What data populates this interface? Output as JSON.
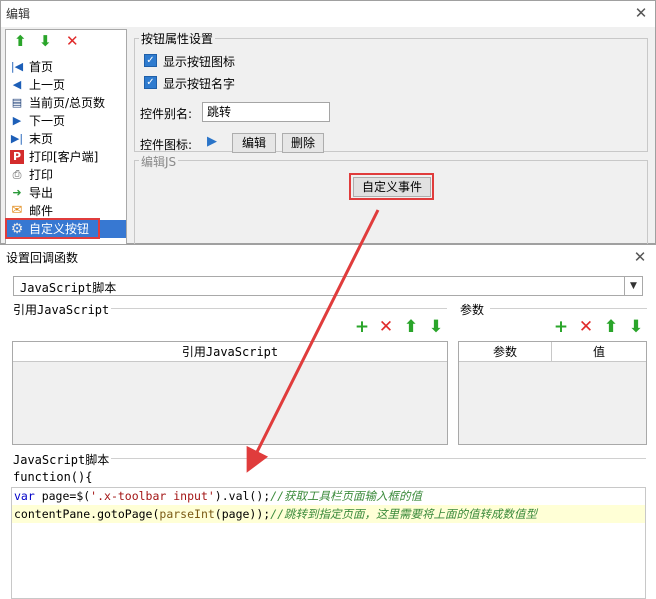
{
  "bg_dialog": {
    "title": "编辑",
    "close_glyph": "✕",
    "toolbar": [
      "move-up",
      "move-down",
      "delete"
    ],
    "items": [
      {
        "label": "首页",
        "icon": "first-page-icon",
        "glyph": "|◀"
      },
      {
        "label": "上一页",
        "icon": "prev-page-icon",
        "glyph": "◀"
      },
      {
        "label": "当前页/总页数",
        "icon": "page-count-icon",
        "glyph": "▤"
      },
      {
        "label": "下一页",
        "icon": "next-page-icon",
        "glyph": "▶"
      },
      {
        "label": "末页",
        "icon": "last-page-icon",
        "glyph": "▶|"
      },
      {
        "label": "打印[客户端]",
        "icon": "pdf-print-icon",
        "glyph": "P"
      },
      {
        "label": "打印",
        "icon": "printer-icon",
        "glyph": "⎙"
      },
      {
        "label": "导出",
        "icon": "export-icon",
        "glyph": "➜"
      },
      {
        "label": "邮件",
        "icon": "mail-icon",
        "glyph": "✉"
      },
      {
        "label": "自定义按钮",
        "icon": "gear-icon",
        "glyph": "⚙"
      }
    ],
    "button_props": {
      "title": "按钮属性设置",
      "show_icon": "显示按钮图标",
      "show_name": "显示按钮名字",
      "alias_label": "控件别名:",
      "alias_value": "跳转",
      "icon_label": "控件图标:",
      "edit_btn": "编辑",
      "delete_btn": "删除"
    },
    "edit_js": {
      "title": "编辑JS",
      "custom_event_btn": "自定义事件"
    }
  },
  "fg_dialog": {
    "title": "设置回调函数",
    "close_glyph": "✕",
    "type_select": "JavaScript脚本",
    "ref_js_label": "引用JavaScript",
    "ref_js_header": "引用JavaScript",
    "params_label": "参数",
    "params_headers": [
      "参数",
      "值"
    ],
    "script_label": "JavaScript脚本",
    "function_header": "function(){",
    "code": {
      "line1": {
        "kw": "var",
        "a": " page=$(",
        "str": "'.x-toolbar input'",
        "b": ").val();",
        "cmt": "//获取工具栏页面输入框的值"
      },
      "line2": {
        "a": "contentPane.gotoPage(",
        "fn": "parseInt",
        "b": "(page));",
        "cmt": "//跳转到指定页面，这里需要将上面的值转成数值型"
      }
    }
  },
  "colors": {
    "add": "#2aa52a",
    "delete": "#e02a2a",
    "move": "#2aa52a",
    "selection": "#3778d2",
    "annotation": "#e03c3c"
  }
}
